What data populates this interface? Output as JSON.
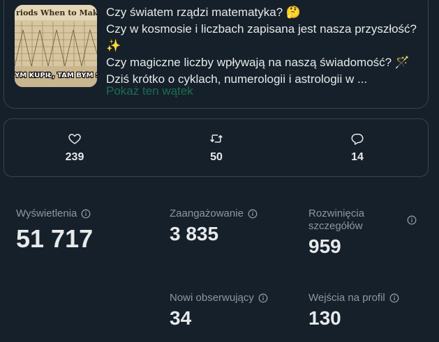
{
  "tweet": {
    "thumbnail": {
      "top_text": "riods When to Make M",
      "bottom_text": "YM KUPIŁ, TAM BYM SPRZ"
    },
    "lines": [
      "Czy światem rządzi matematyka?",
      "Czy w kosmosie i liczbach zapisana jest nasza przyszłość?",
      "Czy magiczne liczby wpływają na naszą świadomość?",
      "Dziś krótko o cyklach, numerologii i astrologii w ..."
    ],
    "emojis": {
      "thinking": "🤔",
      "sparkles": "✨",
      "wand": "🪄"
    },
    "show_thread": "Pokaż ten wątek"
  },
  "engagement": {
    "likes": "239",
    "retweets": "50",
    "replies": "14"
  },
  "metrics": {
    "views": {
      "label": "Wyświetlenia",
      "value": "51 717"
    },
    "engagements": {
      "label": "Zaangażowanie",
      "value": "3 835"
    },
    "detail_expands": {
      "label_line1": "Rozwinięcia",
      "label_line2": "szczegółów",
      "value": "959"
    },
    "new_followers": {
      "label": "Nowi obserwujący",
      "value": "34"
    },
    "profile_visits": {
      "label": "Wejścia na profil",
      "value": "130"
    }
  },
  "colors": {
    "background": "#15202b",
    "border": "#38444d",
    "text": "#e7e9ea",
    "muted": "#8b98a5",
    "link": "#1b6e4e"
  }
}
